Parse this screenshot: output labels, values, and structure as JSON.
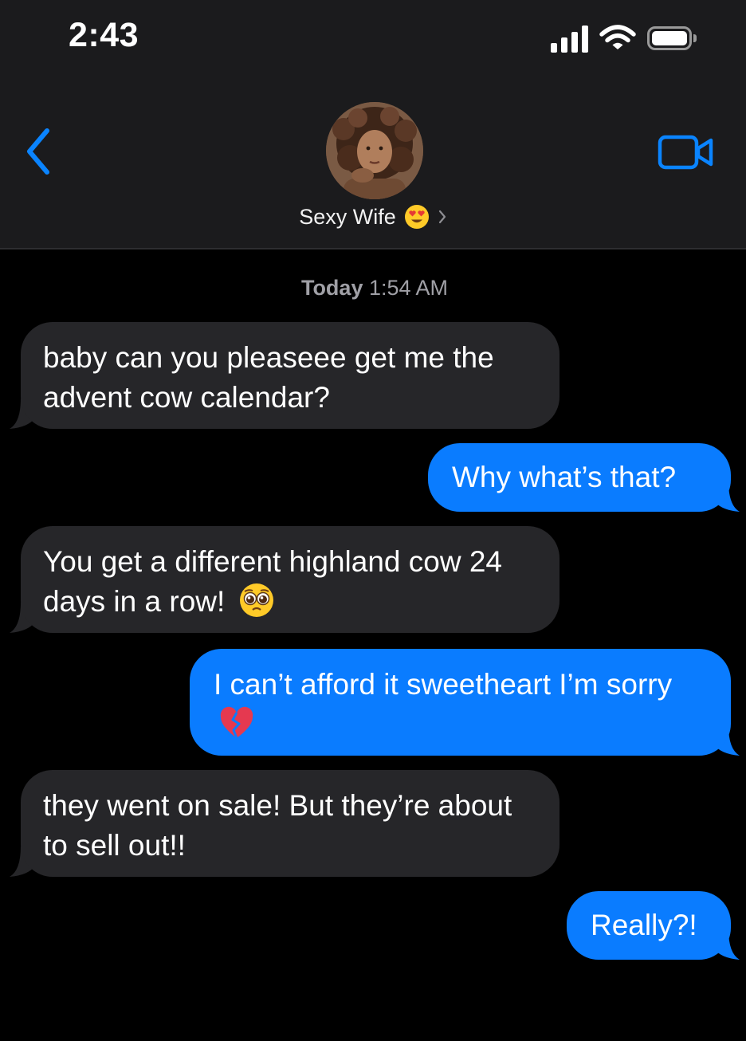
{
  "status_bar": {
    "time": "2:43"
  },
  "header": {
    "contact_name": "Sexy Wife",
    "name_emoji": "heart-eyes-emoji"
  },
  "conversation": {
    "timestamp_day": "Today",
    "timestamp_time": "1:54 AM",
    "messages": [
      {
        "direction": "incoming",
        "text": "baby can you pleaseee get me the advent cow calendar?"
      },
      {
        "direction": "outgoing",
        "text": "Why what’s that?"
      },
      {
        "direction": "incoming",
        "text": "You get a different highland cow 24 days in a row!",
        "emoji": "pleading-face-emoji"
      },
      {
        "direction": "outgoing",
        "text": "I can’t afford it sweetheart I’m sorry",
        "emoji": "broken-heart-emoji"
      },
      {
        "direction": "incoming",
        "text": "they went on sale! But they’re about to sell out!!"
      },
      {
        "direction": "outgoing",
        "text": "Really?!"
      }
    ]
  },
  "colors": {
    "background": "#000000",
    "header_bg": "#1b1b1d",
    "incoming_bubble": "#262629",
    "outgoing_bubble": "#0a7cff",
    "accent": "#0a84ff",
    "timestamp": "#a0a0a6"
  }
}
